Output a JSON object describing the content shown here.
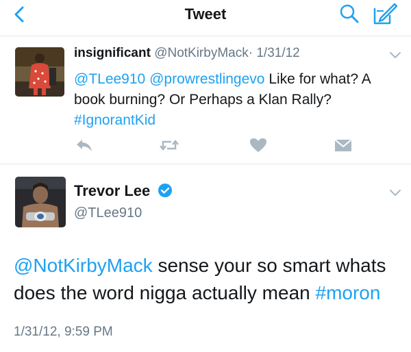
{
  "nav": {
    "title": "Tweet",
    "back_icon": "back-chevron-icon",
    "search_icon": "search-icon",
    "compose_icon": "compose-icon",
    "accent": "#1da1f2"
  },
  "reply_tweet": {
    "name": "insignificant",
    "handle": "@NotKirbyMack",
    "separator": "·",
    "date": "1/31/12",
    "mention1": "@TLee910",
    "mention2": "@prowrestlingevo",
    "text": "Like for what? A book burning? Or Perhaps a Klan Rally?",
    "hashtag": "#IgnorantKid",
    "actions": [
      "reply-icon",
      "retweet-icon",
      "like-icon",
      "direct-message-icon"
    ]
  },
  "main_tweet": {
    "name": "Trevor Lee",
    "handle": "@TLee910",
    "verified": true,
    "mention": "@NotKirbyMack",
    "text": "sense your so smart whats does the word nigga actually mean",
    "hashtag": "#moron",
    "timestamp": "1/31/12, 9:59 PM"
  },
  "colors": {
    "link": "#1da1f2",
    "muted": "#657786",
    "text": "#14171a",
    "divider": "#e1e8ed",
    "action_icon": "#aab8c2"
  }
}
